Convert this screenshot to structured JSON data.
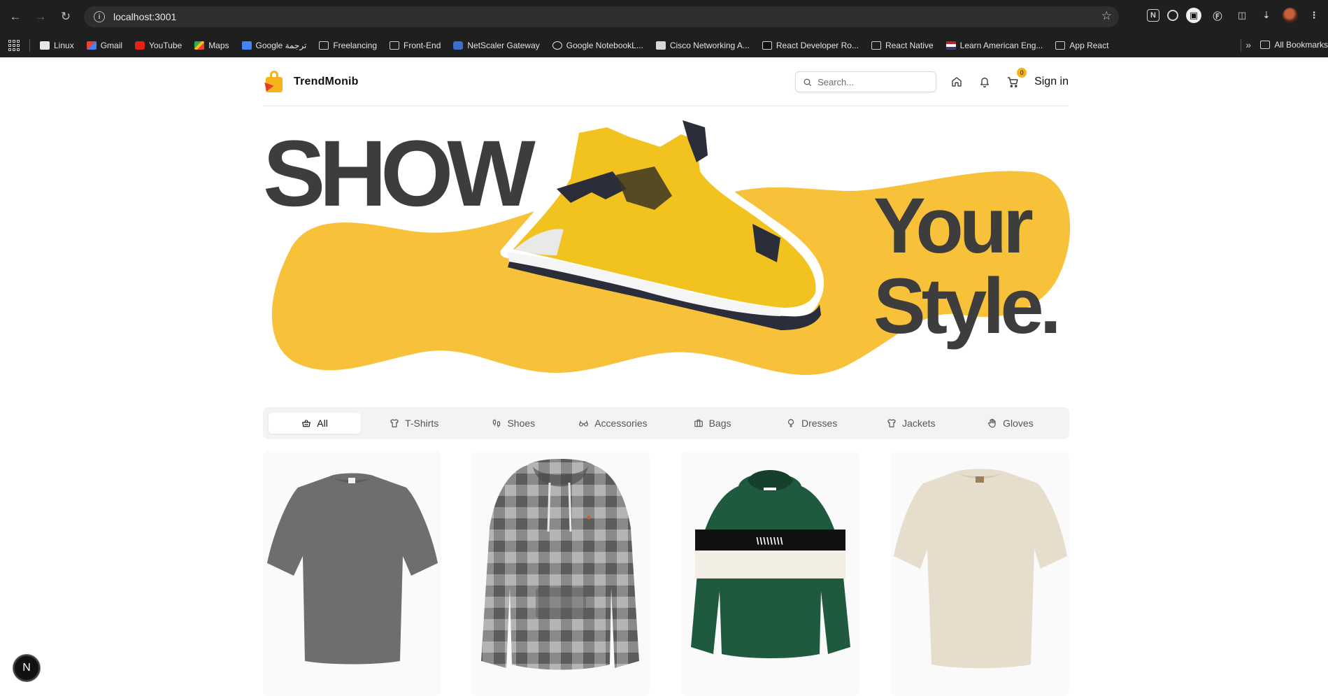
{
  "browser": {
    "url": "localhost:3001",
    "bookmarks": [
      {
        "label": "Linux",
        "icon": "tile-icon"
      },
      {
        "label": "Gmail",
        "icon": "gmail-icon"
      },
      {
        "label": "YouTube",
        "icon": "youtube-icon"
      },
      {
        "label": "Maps",
        "icon": "maps-icon"
      },
      {
        "label": "Google ترجمة",
        "icon": "translate-icon"
      },
      {
        "label": "Freelancing",
        "icon": "folder-icon"
      },
      {
        "label": "Front-End",
        "icon": "folder-icon"
      },
      {
        "label": "NetScaler Gateway",
        "icon": "netscaler-icon"
      },
      {
        "label": "Google NotebookL...",
        "icon": "notebook-icon"
      },
      {
        "label": "Cisco Networking A...",
        "icon": "cisco-icon"
      },
      {
        "label": "React Developer Ro...",
        "icon": "react-icon"
      },
      {
        "label": "React Native",
        "icon": "folder-icon"
      },
      {
        "label": "Learn American Eng...",
        "icon": "flag-icon"
      },
      {
        "label": "App React",
        "icon": "folder-icon"
      }
    ],
    "more": "»",
    "all_bookmarks": "All Bookmarks"
  },
  "header": {
    "brand": "TrendMonib",
    "search_placeholder": "Search...",
    "cart_count": "0",
    "sign_in": "Sign in"
  },
  "hero": {
    "line1": "SHOW",
    "line2": "Your",
    "line3": "Style.",
    "accent_color": "#F8C13A",
    "text_color": "#3D3D3D"
  },
  "categories": [
    {
      "label": "All",
      "icon": "basket-icon",
      "active": true
    },
    {
      "label": "T-Shirts",
      "icon": "shirt-icon"
    },
    {
      "label": "Shoes",
      "icon": "footprints-icon"
    },
    {
      "label": "Accessories",
      "icon": "glasses-icon"
    },
    {
      "label": "Bags",
      "icon": "briefcase-icon"
    },
    {
      "label": "Dresses",
      "icon": "dress-icon"
    },
    {
      "label": "Jackets",
      "icon": "jacket-icon"
    },
    {
      "label": "Gloves",
      "icon": "hand-icon"
    }
  ],
  "products": [
    {
      "name": "grey-tshirt",
      "color": "#6e6e70"
    },
    {
      "name": "plaid-hoodie",
      "color": "#6b6b6b"
    },
    {
      "name": "green-striped-hoodie",
      "color": "#1f5a3e"
    },
    {
      "name": "beige-tshirt",
      "color": "#e6ddcd"
    }
  ],
  "next_badge": "N"
}
